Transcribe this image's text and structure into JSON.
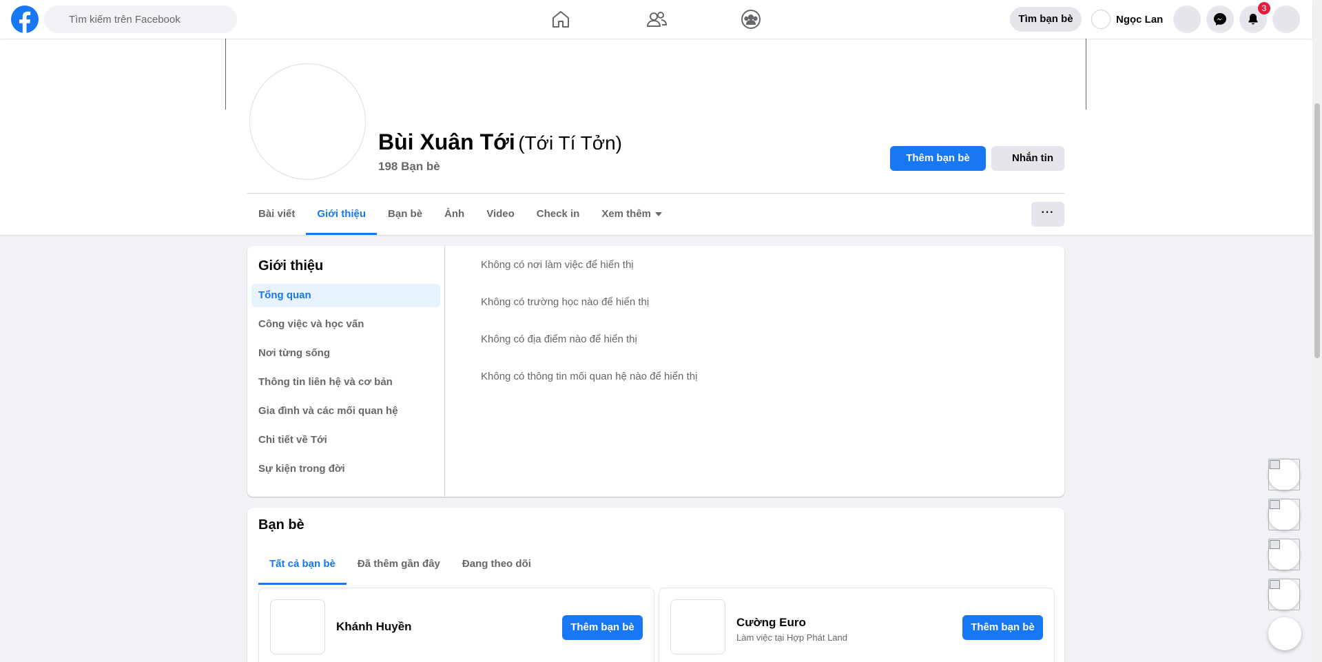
{
  "topbar": {
    "search_placeholder": "Tìm kiếm trên Facebook",
    "nav_icons": [
      "home-icon",
      "friends-icon",
      "groups-icon"
    ],
    "find_friends_label": "Tìm bạn bè",
    "user_name": "Ngọc Lan",
    "notification_count": "3"
  },
  "profile": {
    "name": "Bùi Xuân Tới",
    "alternate_name": "(Tới Tí Tởn)",
    "friends_count": "198 Bạn bè",
    "add_friend_label": "Thêm bạn bè",
    "message_label": "Nhắn tin",
    "more_label": "···"
  },
  "tabs": [
    {
      "label": "Bài viết",
      "active": false
    },
    {
      "label": "Giới thiệu",
      "active": true
    },
    {
      "label": "Bạn bè",
      "active": false
    },
    {
      "label": "Ảnh",
      "active": false
    },
    {
      "label": "Video",
      "active": false
    },
    {
      "label": "Check in",
      "active": false
    },
    {
      "label": "Xem thêm",
      "active": false
    }
  ],
  "about": {
    "title": "Giới thiệu",
    "menu": [
      "Tổng quan",
      "Công việc và học vấn",
      "Nơi từng sống",
      "Thông tin liên hệ và cơ bản",
      "Gia đình và các mối quan hệ",
      "Chi tiết về Tới",
      "Sự kiện trong đời"
    ],
    "active_index": 0,
    "lines": [
      "Không có nơi làm việc để hiển thị",
      "Không có trường học nào để hiển thị",
      "Không có địa điểm nào để hiển thị",
      "Không có thông tin mối quan hệ nào để hiển thị"
    ]
  },
  "friends": {
    "title": "Bạn bè",
    "tabs": [
      "Tất cả bạn bè",
      "Đã thêm gần đây",
      "Đang theo dõi"
    ],
    "items": [
      {
        "name": "Khánh Huyền",
        "subtitle": "",
        "action": "Thêm bạn bè"
      },
      {
        "name": "Cường Euro",
        "subtitle": "Làm việc tại Hợp Phát Land",
        "action": "Thêm bạn bè"
      }
    ]
  },
  "colors": {
    "accent": "#1877f2",
    "page_bg": "#f0f2f5",
    "secondary_text": "#65676b",
    "badge": "#e41e3f"
  }
}
